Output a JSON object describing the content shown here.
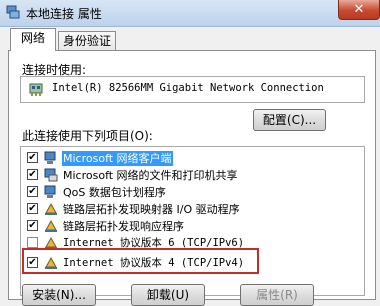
{
  "window": {
    "title": "本地连接 属性",
    "close": "✕"
  },
  "tabs": [
    {
      "label": "网络",
      "active": true
    },
    {
      "label": "身份验证",
      "active": false
    }
  ],
  "connect_using": {
    "label": "连接时使用:",
    "adapter": "Intel(R) 82566MM Gigabit Network Connection"
  },
  "buttons": {
    "configure": "配置(C)...",
    "install": "安装(N)...",
    "uninstall": "卸载(U)",
    "properties": "属性(R)"
  },
  "items_label": "此连接使用下列项目(O):",
  "items": [
    {
      "label": "Microsoft 网络客户端",
      "checked": true,
      "selected": true,
      "icon": "network-client-icon"
    },
    {
      "label": "Microsoft 网络的文件和打印机共享",
      "checked": true,
      "selected": false,
      "icon": "printer-share-icon"
    },
    {
      "label": "QoS 数据包计划程序",
      "checked": true,
      "selected": false,
      "icon": "qos-icon"
    },
    {
      "label": "链路层拓扑发现映射器 I/O 驱动程序",
      "checked": true,
      "selected": false,
      "icon": "protocol-icon"
    },
    {
      "label": "链路层拓扑发现响应程序",
      "checked": true,
      "selected": false,
      "icon": "protocol-icon"
    },
    {
      "label": "Internet 协议版本 6 (TCP/IPv6)",
      "checked": false,
      "selected": false,
      "icon": "protocol-icon"
    },
    {
      "label": "Internet 协议版本 4 (TCP/IPv4)",
      "checked": true,
      "selected": false,
      "icon": "protocol-icon"
    }
  ],
  "colors": {
    "highlight_frame": "#c0302a",
    "selection": "#3399ff"
  }
}
